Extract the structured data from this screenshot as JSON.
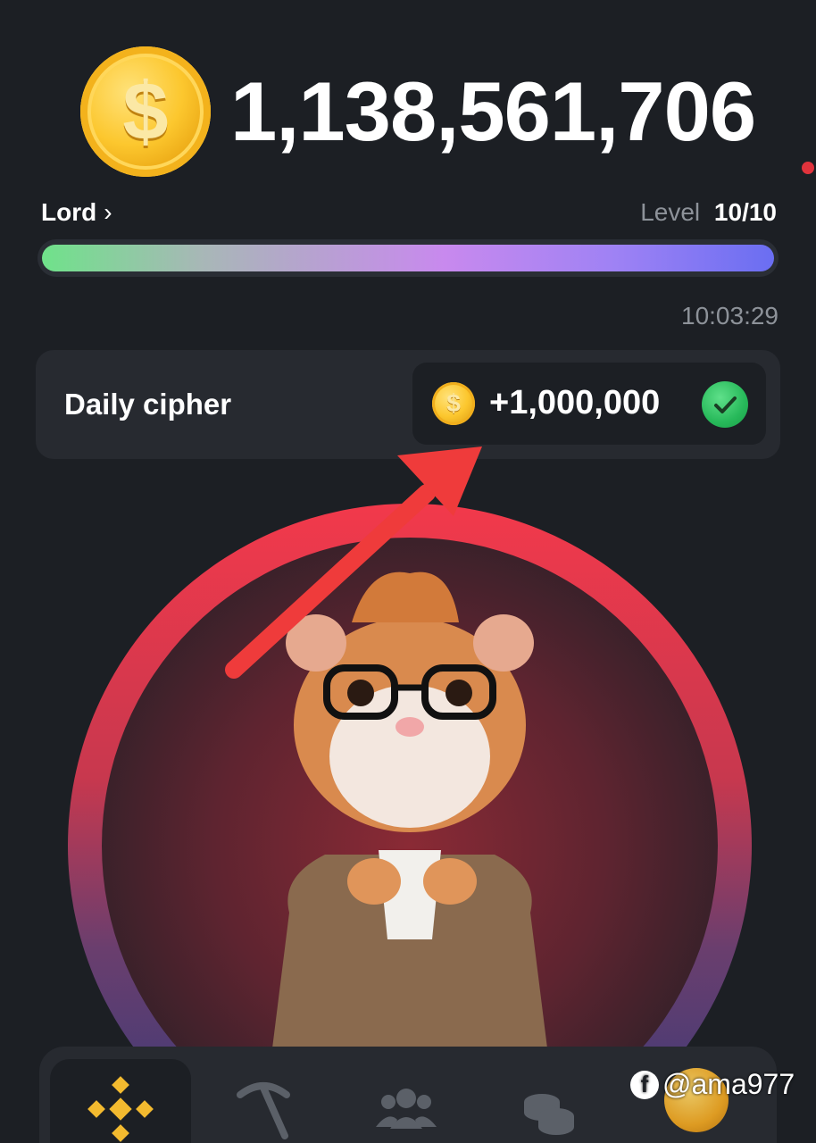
{
  "header": {
    "balance": "1,138,561,706",
    "coin_symbol": "$"
  },
  "rank": {
    "name": "Lord",
    "chevron": "›",
    "level_label": "Level",
    "level_value": "10/10",
    "progress": 1.0
  },
  "timer": "10:03:29",
  "daily_cipher": {
    "title": "Daily cipher",
    "reward": "+1,000,000",
    "coin_symbol": "$",
    "status_icon": "check-icon"
  },
  "nav": {
    "items": [
      {
        "name": "exchange",
        "icon": "binance-icon",
        "active": true
      },
      {
        "name": "mine",
        "icon": "pickaxe-icon",
        "active": false
      },
      {
        "name": "friends",
        "icon": "friends-icon",
        "active": false
      },
      {
        "name": "earn",
        "icon": "coins-icon",
        "active": false
      },
      {
        "name": "airdrop",
        "icon": "airdrop-coin-icon",
        "active": false
      }
    ]
  },
  "watermark": {
    "text": "@ama977",
    "icon": "facebook-icon"
  },
  "colors": {
    "background": "#1c1f24",
    "card": "#272a30",
    "coin": "#fcc72e",
    "check": "#27b95a",
    "arrow": "#ef3b3b",
    "ring_top": "#f2394b",
    "ring_bottom": "#2f3a7a"
  }
}
